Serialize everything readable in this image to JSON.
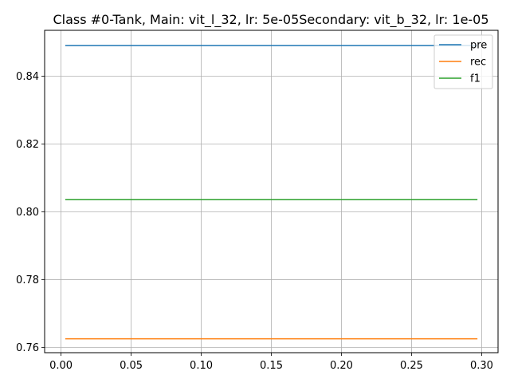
{
  "chart_data": {
    "type": "line",
    "title": "Class #0-Tank, Main: vit_l_32, lr: 5e-05Secondary: vit_b_32, lr: 1e-05",
    "xlabel": "",
    "ylabel": "",
    "xlim": [
      -0.0117,
      0.3117
    ],
    "ylim": [
      0.7585,
      0.8535
    ],
    "x_ticks": [
      "0.00",
      "0.05",
      "0.10",
      "0.15",
      "0.20",
      "0.25",
      "0.30"
    ],
    "y_ticks": [
      "0.76",
      "0.78",
      "0.80",
      "0.82",
      "0.84"
    ],
    "x_tick_values": [
      0.0,
      0.05,
      0.1,
      0.15,
      0.2,
      0.25,
      0.3
    ],
    "y_tick_values": [
      0.76,
      0.78,
      0.8,
      0.82,
      0.84
    ],
    "grid": true,
    "legend_position": "top-right",
    "series": [
      {
        "name": "pre",
        "color": "#1f77b4",
        "x": [
          0.003,
          0.297
        ],
        "y": [
          0.849,
          0.849
        ]
      },
      {
        "name": "rec",
        "color": "#ff7f0e",
        "x": [
          0.003,
          0.297
        ],
        "y": [
          0.7626,
          0.7626
        ]
      },
      {
        "name": "f1",
        "color": "#2ca02c",
        "x": [
          0.003,
          0.297
        ],
        "y": [
          0.8036,
          0.8036
        ]
      }
    ]
  }
}
